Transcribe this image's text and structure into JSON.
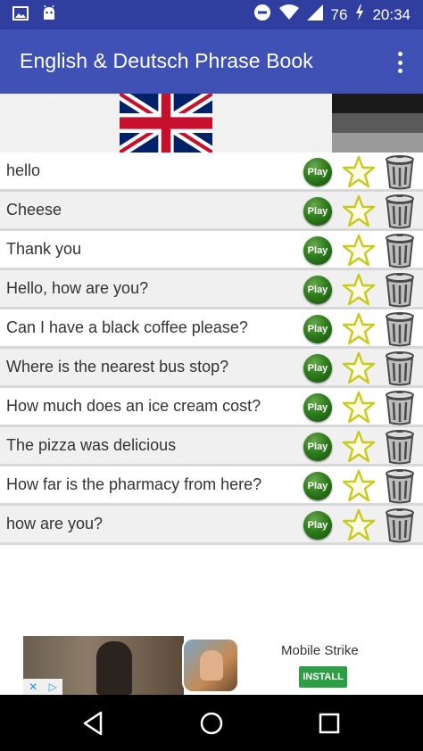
{
  "status_bar": {
    "battery_level": "76",
    "time": "20:34",
    "icons": [
      "image-icon",
      "android-icon",
      "do-not-disturb-icon",
      "wifi-icon",
      "signal-icon",
      "battery-charging-icon"
    ]
  },
  "app_bar": {
    "title": "English & Deutsch Phrase Book",
    "overflow_icon": "more-vert-icon"
  },
  "flags": {
    "left": "uk-flag",
    "right": "german-flag"
  },
  "phrases": [
    {
      "text": "hello",
      "play_label": "Play"
    },
    {
      "text": "Cheese",
      "play_label": "Play"
    },
    {
      "text": "Thank you",
      "play_label": "Play"
    },
    {
      "text": "Hello, how are you?",
      "play_label": "Play"
    },
    {
      "text": "Can I have a black coffee please?",
      "play_label": "Play"
    },
    {
      "text": "Where is the nearest bus stop?",
      "play_label": "Play"
    },
    {
      "text": "How much does an ice cream cost?",
      "play_label": "Play"
    },
    {
      "text": "The pizza was delicious",
      "play_label": "Play"
    },
    {
      "text": "How far is the pharmacy from here?",
      "play_label": "Play"
    },
    {
      "text": "how are you?",
      "play_label": "Play"
    }
  ],
  "ad": {
    "title": "Mobile Strike",
    "install_label": "INSTALL"
  },
  "nav_bar": {
    "icons": [
      "back-icon",
      "home-icon",
      "recents-icon"
    ]
  },
  "colors": {
    "app_bar": "#3F51B5",
    "status_bar": "#303F9F",
    "play_button": "#2f7d1c",
    "star": "#c9c91a",
    "install": "#2e9e44"
  }
}
